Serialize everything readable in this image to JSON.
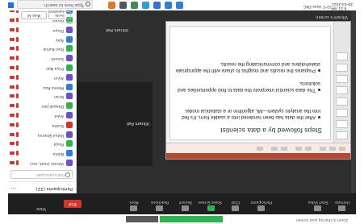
{
  "taskbar": {
    "search_placeholder": "Type here to search",
    "tray_text": "33°C  Haze  ENG",
    "clock_time": "9:11 AM",
    "clock_date": "26-03-2021"
  },
  "zoom_toolbar": {
    "items": [
      {
        "label": "Unmute",
        "icon": "mic-icon"
      },
      {
        "label": "Start Video",
        "icon": "video-icon"
      },
      {
        "label": "Participants",
        "icon": "participants-icon",
        "count": "22"
      },
      {
        "label": "Chat",
        "icon": "chat-icon"
      },
      {
        "label": "Share Screen",
        "icon": "share-screen-icon"
      },
      {
        "label": "Record",
        "icon": "record-icon"
      },
      {
        "label": "Reactions",
        "icon": "reactions-icon"
      },
      {
        "label": "More",
        "icon": "more-icon"
      }
    ],
    "end_label": "End",
    "view_label": "View"
  },
  "participants": {
    "title": "Participants (22)",
    "options": "•••",
    "search_placeholder": "Find a participant",
    "rows": [
      {
        "name": "Vikram (Host, me)",
        "color": "#6f4fc9"
      },
      {
        "name": "Nikita",
        "color": "#2f7fd6"
      },
      {
        "name": "Pooja",
        "color": "#2fb34f"
      },
      {
        "name": "Rahul Sharma",
        "color": "#6f4fc9"
      },
      {
        "name": "Sneha",
        "color": "#d9342b"
      },
      {
        "name": "Ankit",
        "color": "#6f4fc9"
      },
      {
        "name": "Deepak Jain",
        "color": "#2fb34f"
      },
      {
        "name": "Kiran",
        "color": "#6f4fc9"
      },
      {
        "name": "Meena Rao",
        "color": "#2f7fd6"
      },
      {
        "name": "Arjun",
        "color": "#6f4fc9"
      },
      {
        "name": "Priya Nair",
        "color": "#2fb34f"
      },
      {
        "name": "Suresh",
        "color": "#6f4fc9"
      },
      {
        "name": "Ravi Kumar",
        "color": "#2fb34f"
      },
      {
        "name": "Ajay",
        "color": "#2f7fd6"
      },
      {
        "name": "Divya",
        "color": "#6f4fc9"
      },
      {
        "name": "Karan",
        "color": "#2fb34f"
      },
      {
        "name": "Lakshmi",
        "color": "#2f7fd6"
      }
    ],
    "invite_label": "Invite",
    "mute_all_label": "Mute All"
  },
  "stage": {
    "speaker_name": "Vikram Pati",
    "shared_name": "Vikram Pati",
    "view_label": "Vikram's screen"
  },
  "slide": {
    "title": "Steps followed by a data scientist",
    "bullets": [
      "After the data has been rendered into a usable form, it's fed into the analytic system—ML algorithm or a statistical model.",
      "The data scientist interprets the data to find opportunities and solutions.",
      "Prepares the results and insights to share with the appropriate stakeholders and communicating the results."
    ]
  },
  "status": {
    "left_text": "Zoom is sharing your screen"
  },
  "colors": {
    "accent_red": "#d9342b",
    "zoom_green": "#2fb34f",
    "toolbar_bg": "#1f1f1f"
  }
}
